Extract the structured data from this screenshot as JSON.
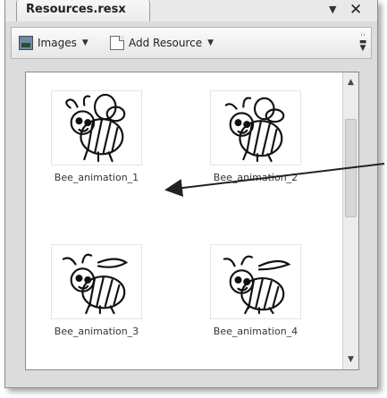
{
  "window": {
    "tab_title": "Resources.resx"
  },
  "toolbar": {
    "images_label": "Images",
    "add_resource_label": "Add Resource"
  },
  "resources": [
    {
      "name": "Bee_animation_1"
    },
    {
      "name": "Bee_animation_2"
    },
    {
      "name": "Bee_animation_3"
    },
    {
      "name": "Bee_animation_4"
    }
  ],
  "icons": {
    "dropdown": "caret-down-icon",
    "close": "close-icon",
    "images": "image-icon",
    "add_resource": "document-icon"
  },
  "colors": {
    "window_bg": "#dcdcdc",
    "content_bg": "#ffffff",
    "arrow": "#222222"
  }
}
